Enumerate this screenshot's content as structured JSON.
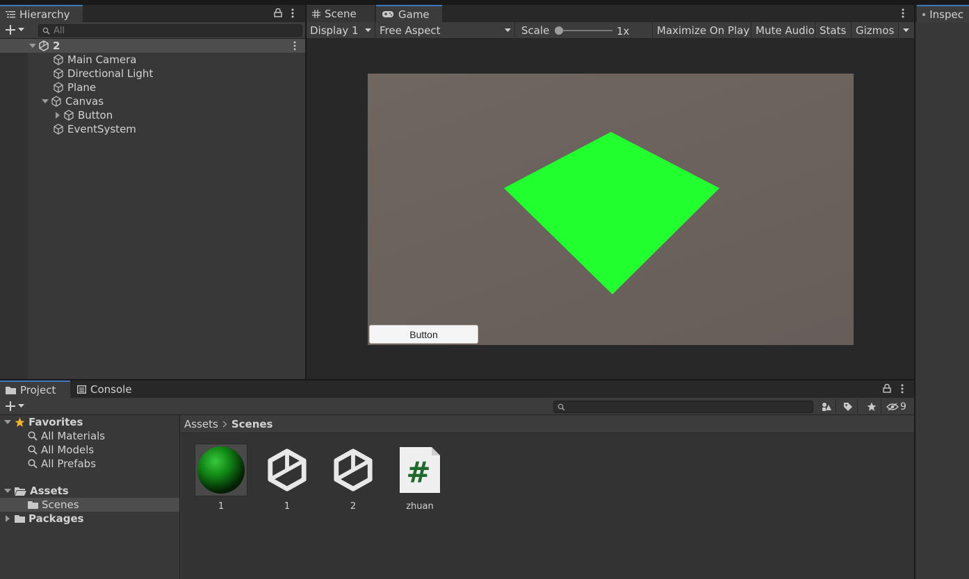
{
  "hierarchy": {
    "tab_label": "Hierarchy",
    "search_placeholder": "All",
    "scene_name": "2",
    "items": [
      {
        "label": "Main Camera"
      },
      {
        "label": "Directional Light"
      },
      {
        "label": "Plane"
      },
      {
        "label": "Canvas"
      },
      {
        "label": "Button"
      },
      {
        "label": "EventSystem"
      }
    ]
  },
  "game": {
    "tabs": [
      {
        "label": "Scene"
      },
      {
        "label": "Game"
      }
    ],
    "display": "Display 1",
    "aspect": "Free Aspect",
    "scale_label": "Scale",
    "scale_value": "1x",
    "maximize": "Maximize On Play",
    "mute": "Mute Audio",
    "stats": "Stats",
    "gizmos": "Gizmos",
    "view_button_label": "Button",
    "plane_color": "#22ff2f",
    "background_color": "#6b625d"
  },
  "inspector": {
    "tab_label": "Inspec"
  },
  "project": {
    "tabs": [
      {
        "label": "Project"
      },
      {
        "label": "Console"
      }
    ],
    "hidden_count": "9",
    "favorites": {
      "label": "Favorites",
      "items": [
        {
          "label": "All Materials"
        },
        {
          "label": "All Models"
        },
        {
          "label": "All Prefabs"
        }
      ]
    },
    "assets_label": "Assets",
    "scenes_label": "Scenes",
    "packages_label": "Packages",
    "breadcrumb": [
      "Assets",
      "Scenes"
    ],
    "assets": [
      {
        "name": "1",
        "icon": "material-sphere-icon"
      },
      {
        "name": "1",
        "icon": "unity-scene-icon"
      },
      {
        "name": "2",
        "icon": "unity-scene-icon"
      },
      {
        "name": "zhuan",
        "icon": "csharp-script-icon"
      }
    ]
  },
  "colors": {
    "accent": "#3a79bb",
    "selected": "#4d4d4d"
  }
}
